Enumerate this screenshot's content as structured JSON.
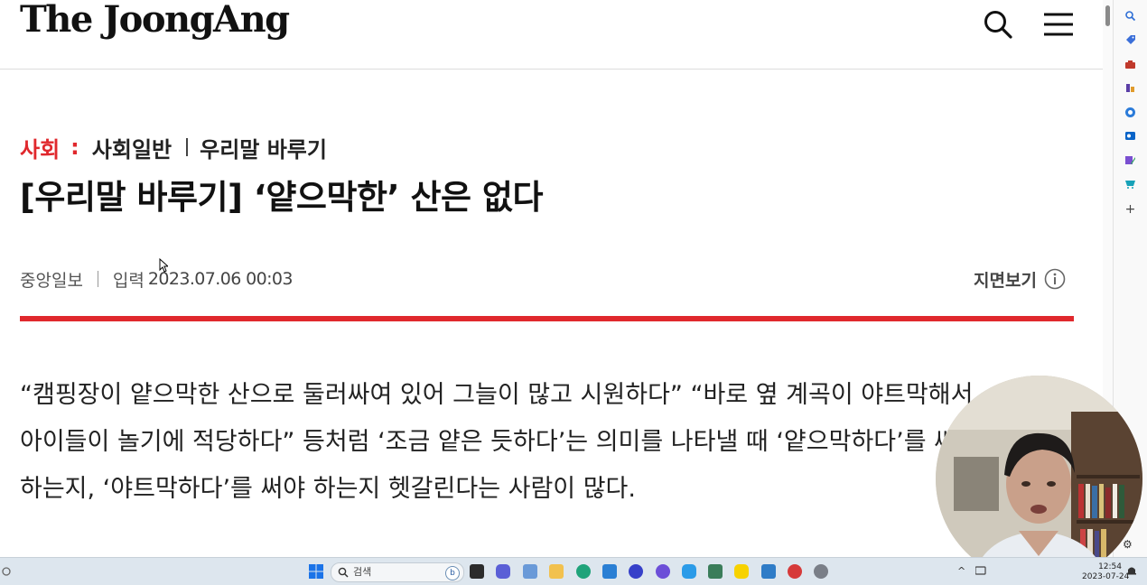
{
  "header": {
    "logo": "The JoongAng",
    "search_icon": "search-icon",
    "menu_icon": "hamburger-menu-icon"
  },
  "article": {
    "category_main": "사회",
    "category_separator": ":",
    "category_sub": "사회일반",
    "category_series": "우리말 바루기",
    "title": "[우리말 바루기] ‘얕으막한’ 산은 없다",
    "source": "중앙일보",
    "date_label": "입력",
    "date_value": "2023.07.06 00:03",
    "print_view_label": "지면보기",
    "print_view_icon": "info-circle-icon",
    "body_lines": [
      "“캠핑장이 얕으막한 산으로 둘러싸여 있어 그늘이 많고 시원하다” “바로 옆 계곡이 야트막해서",
      "아이들이 놀기에 적당하다” 등처럼 ‘조금 얕은 듯하다’는 의미를 나타낼 때 ‘얕으막하다’를 써야",
      "하는지, ‘야트막하다’를 써야 하는지 헷갈린다는 사람이 많다."
    ],
    "accent_color": "#e0282d"
  },
  "sidebar": {
    "items": [
      "search-icon",
      "tag-icon",
      "briefcase-icon",
      "chess-icon",
      "office-icon",
      "outlook-icon",
      "edit-icon",
      "shopping-icon",
      "add-icon"
    ],
    "add_label": "+"
  },
  "webcam": {
    "settings_icon": "gear-icon",
    "settings_glyph": "⚙"
  },
  "taskbar": {
    "search_placeholder": "검색",
    "bing_label": "b",
    "start_icon": "windows-start-icon",
    "clock_time": "12:54",
    "clock_date": "2023-07-24",
    "tray_chevron": "^"
  }
}
